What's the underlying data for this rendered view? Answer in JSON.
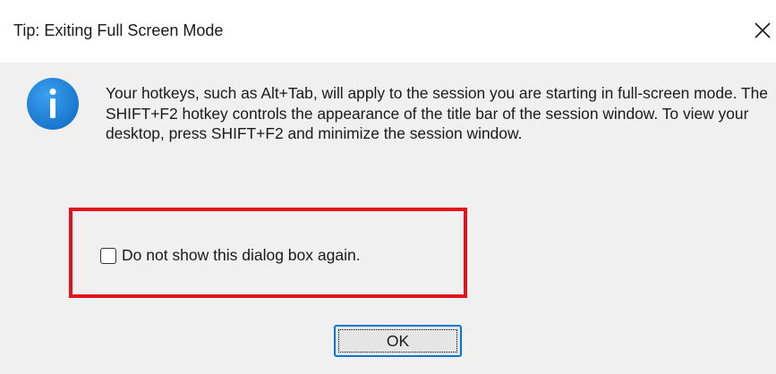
{
  "dialog": {
    "title": "Tip: Exiting Full Screen Mode",
    "close_icon": "close-icon",
    "icon": "info-icon",
    "message": "Your hotkeys, such as Alt+Tab, will apply to the session you are starting in full-screen mode. The SHIFT+F2 hotkey controls the appearance of the title bar of the session window. To view your desktop, press SHIFT+F2 and minimize the session window.",
    "checkbox": {
      "label": "Do not show this dialog box again.",
      "checked": false
    },
    "ok_label": "OK"
  },
  "colors": {
    "info_blue": "#1b82d9",
    "highlight_red": "#e3131e",
    "button_focus_blue": "#0078d4",
    "body_bg": "#f0f0f0",
    "titlebar_bg": "#ffffff"
  }
}
